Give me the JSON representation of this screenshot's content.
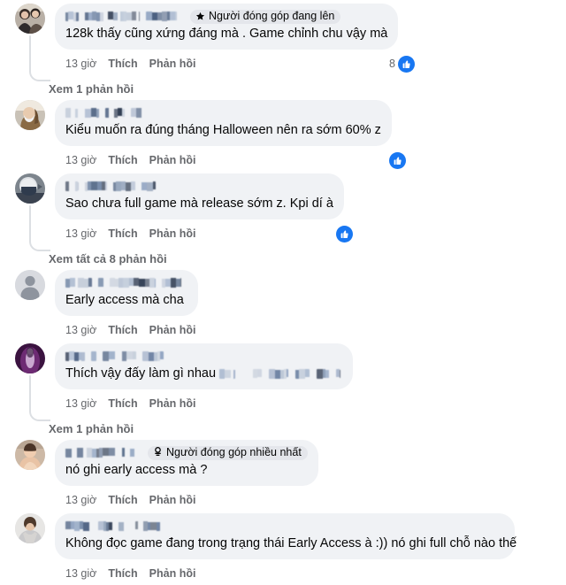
{
  "app": {
    "platform": "facebook-comments",
    "accent_color": "#1877f2",
    "bubble_color": "#f0f2f5",
    "text_color": "#050505",
    "meta_color": "#65676b"
  },
  "labels": {
    "like": "Thích",
    "reply": "Phản hồi",
    "time": "13 giờ"
  },
  "comments": [
    {
      "id": "c1",
      "avatar": "couple-photo",
      "name_redacted": true,
      "badge": {
        "icon": "star-icon",
        "label": "Người đóng góp đang lên"
      },
      "text": "128k thấy cũng xứng đáng mà . Game chỉnh chu vậy mà",
      "time": "13 giờ",
      "like": "Thích",
      "reply": "Phản hồi",
      "reaction_count": "8",
      "reaction_icon": "thumbs-up-icon",
      "view_replies": "Xem 1 phản hồi"
    },
    {
      "id": "c2",
      "avatar": "woman-mask-photo",
      "name_redacted": true,
      "badge": null,
      "text": "Kiểu muốn ra đúng tháng Halloween nên ra sớm 60% z",
      "time": "13 giờ",
      "like": "Thích",
      "reply": "Phản hồi",
      "reaction_count": "",
      "reaction_icon": "thumbs-up-icon",
      "view_replies": null
    },
    {
      "id": "c3",
      "avatar": "helmet-photo",
      "name_redacted": true,
      "badge": null,
      "text": "Sao chưa full game mà release sớm z. Kpi dí à",
      "time": "13 giờ",
      "like": "Thích",
      "reply": "Phản hồi",
      "reaction_count": "",
      "reaction_icon": "thumbs-up-icon",
      "view_replies": "Xem tất cả 8 phản hồi"
    },
    {
      "id": "c4",
      "avatar": "default-silhouette",
      "name_redacted": true,
      "badge": null,
      "text": "Early access mà cha",
      "time": "13 giờ",
      "like": "Thích",
      "reply": "Phản hồi",
      "reaction_count": "",
      "reaction_icon": null,
      "view_replies": null
    },
    {
      "id": "c5",
      "avatar": "purple-photo",
      "name_redacted": true,
      "badge": null,
      "text": "Thích vậy đấy làm gì nhau",
      "text_has_trailing_redaction": true,
      "time": "13 giờ",
      "like": "Thích",
      "reply": "Phản hồi",
      "reaction_count": "",
      "reaction_icon": null,
      "view_replies": "Xem 1 phản hồi"
    },
    {
      "id": "c6",
      "avatar": "portrait-photo",
      "name_redacted": true,
      "badge": {
        "icon": "top-contributor-icon",
        "label": "Người đóng góp nhiều nhất"
      },
      "text": "nó ghi early access mà ?",
      "time": "13 giờ",
      "like": "Thích",
      "reply": "Phản hồi",
      "reaction_count": "",
      "reaction_icon": null,
      "view_replies": null
    },
    {
      "id": "c7",
      "avatar": "grey-sweater-photo",
      "name_redacted": true,
      "badge": null,
      "text": "Không đọc game đang trong trạng thái Early Access à :)) nó ghi full chỗ nào thế",
      "time": "13 giờ",
      "like": "Thích",
      "reply": "Phản hồi",
      "reaction_count": "",
      "reaction_icon": null,
      "view_replies": null
    }
  ]
}
